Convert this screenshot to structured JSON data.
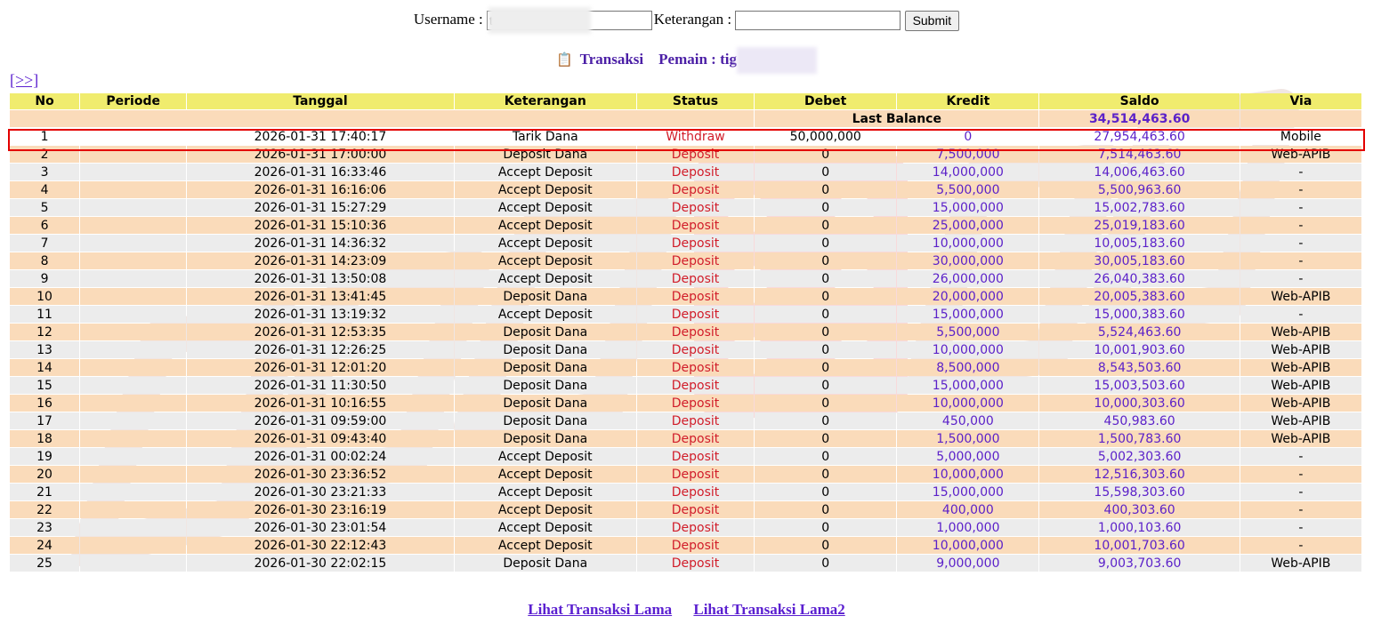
{
  "form": {
    "username_label": "Username :",
    "username_value": "t",
    "keterangan_label": "Keterangan :",
    "keterangan_value": "",
    "submit_label": "Submit"
  },
  "heading": {
    "icon": "clipboard-icon",
    "transaksi": "Transaksi",
    "pemain": "Pemain : tig"
  },
  "next_link": "[>>]",
  "columns": [
    "No",
    "Periode",
    "Tanggal",
    "Keterangan",
    "Status",
    "Debet",
    "Kredit",
    "Saldo",
    "Via"
  ],
  "last_balance": {
    "label": "Last Balance",
    "value": "34,514,463.60"
  },
  "rows": [
    {
      "no": "1",
      "periode": "",
      "tanggal": "2026-01-31 17:40:17",
      "keterangan": "Tarik Dana",
      "status": "Withdraw",
      "debet": "50,000,000",
      "kredit": "0",
      "saldo": "27,954,463.60",
      "via": "Mobile"
    },
    {
      "no": "2",
      "periode": "",
      "tanggal": "2026-01-31 17:00:00",
      "keterangan": "Deposit Dana",
      "status": "Deposit",
      "debet": "0",
      "kredit": "7,500,000",
      "saldo": "7,514,463.60",
      "via": "Web-APIB"
    },
    {
      "no": "3",
      "periode": "",
      "tanggal": "2026-01-31 16:33:46",
      "keterangan": "Accept Deposit",
      "status": "Deposit",
      "debet": "0",
      "kredit": "14,000,000",
      "saldo": "14,006,463.60",
      "via": "-"
    },
    {
      "no": "4",
      "periode": "",
      "tanggal": "2026-01-31 16:16:06",
      "keterangan": "Accept Deposit",
      "status": "Deposit",
      "debet": "0",
      "kredit": "5,500,000",
      "saldo": "5,500,963.60",
      "via": "-"
    },
    {
      "no": "5",
      "periode": "",
      "tanggal": "2026-01-31 15:27:29",
      "keterangan": "Accept Deposit",
      "status": "Deposit",
      "debet": "0",
      "kredit": "15,000,000",
      "saldo": "15,002,783.60",
      "via": "-"
    },
    {
      "no": "6",
      "periode": "",
      "tanggal": "2026-01-31 15:10:36",
      "keterangan": "Accept Deposit",
      "status": "Deposit",
      "debet": "0",
      "kredit": "25,000,000",
      "saldo": "25,019,183.60",
      "via": "-"
    },
    {
      "no": "7",
      "periode": "",
      "tanggal": "2026-01-31 14:36:32",
      "keterangan": "Accept Deposit",
      "status": "Deposit",
      "debet": "0",
      "kredit": "10,000,000",
      "saldo": "10,005,183.60",
      "via": "-"
    },
    {
      "no": "8",
      "periode": "",
      "tanggal": "2026-01-31 14:23:09",
      "keterangan": "Accept Deposit",
      "status": "Deposit",
      "debet": "0",
      "kredit": "30,000,000",
      "saldo": "30,005,183.60",
      "via": "-"
    },
    {
      "no": "9",
      "periode": "",
      "tanggal": "2026-01-31 13:50:08",
      "keterangan": "Accept Deposit",
      "status": "Deposit",
      "debet": "0",
      "kredit": "26,000,000",
      "saldo": "26,040,383.60",
      "via": "-"
    },
    {
      "no": "10",
      "periode": "",
      "tanggal": "2026-01-31 13:41:45",
      "keterangan": "Deposit Dana",
      "status": "Deposit",
      "debet": "0",
      "kredit": "20,000,000",
      "saldo": "20,005,383.60",
      "via": "Web-APIB"
    },
    {
      "no": "11",
      "periode": "",
      "tanggal": "2026-01-31 13:19:32",
      "keterangan": "Accept Deposit",
      "status": "Deposit",
      "debet": "0",
      "kredit": "15,000,000",
      "saldo": "15,000,383.60",
      "via": "-"
    },
    {
      "no": "12",
      "periode": "",
      "tanggal": "2026-01-31 12:53:35",
      "keterangan": "Deposit Dana",
      "status": "Deposit",
      "debet": "0",
      "kredit": "5,500,000",
      "saldo": "5,524,463.60",
      "via": "Web-APIB"
    },
    {
      "no": "13",
      "periode": "",
      "tanggal": "2026-01-31 12:26:25",
      "keterangan": "Deposit Dana",
      "status": "Deposit",
      "debet": "0",
      "kredit": "10,000,000",
      "saldo": "10,001,903.60",
      "via": "Web-APIB"
    },
    {
      "no": "14",
      "periode": "",
      "tanggal": "2026-01-31 12:01:20",
      "keterangan": "Deposit Dana",
      "status": "Deposit",
      "debet": "0",
      "kredit": "8,500,000",
      "saldo": "8,543,503.60",
      "via": "Web-APIB"
    },
    {
      "no": "15",
      "periode": "",
      "tanggal": "2026-01-31 11:30:50",
      "keterangan": "Deposit Dana",
      "status": "Deposit",
      "debet": "0",
      "kredit": "15,000,000",
      "saldo": "15,003,503.60",
      "via": "Web-APIB"
    },
    {
      "no": "16",
      "periode": "",
      "tanggal": "2026-01-31 10:16:55",
      "keterangan": "Deposit Dana",
      "status": "Deposit",
      "debet": "0",
      "kredit": "10,000,000",
      "saldo": "10,000,303.60",
      "via": "Web-APIB"
    },
    {
      "no": "17",
      "periode": "",
      "tanggal": "2026-01-31 09:59:00",
      "keterangan": "Deposit Dana",
      "status": "Deposit",
      "debet": "0",
      "kredit": "450,000",
      "saldo": "450,983.60",
      "via": "Web-APIB"
    },
    {
      "no": "18",
      "periode": "",
      "tanggal": "2026-01-31 09:43:40",
      "keterangan": "Deposit Dana",
      "status": "Deposit",
      "debet": "0",
      "kredit": "1,500,000",
      "saldo": "1,500,783.60",
      "via": "Web-APIB"
    },
    {
      "no": "19",
      "periode": "",
      "tanggal": "2026-01-31 00:02:24",
      "keterangan": "Accept Deposit",
      "status": "Deposit",
      "debet": "0",
      "kredit": "5,000,000",
      "saldo": "5,002,303.60",
      "via": "-"
    },
    {
      "no": "20",
      "periode": "",
      "tanggal": "2026-01-30 23:36:52",
      "keterangan": "Accept Deposit",
      "status": "Deposit",
      "debet": "0",
      "kredit": "10,000,000",
      "saldo": "12,516,303.60",
      "via": "-"
    },
    {
      "no": "21",
      "periode": "",
      "tanggal": "2026-01-30 23:21:33",
      "keterangan": "Accept Deposit",
      "status": "Deposit",
      "debet": "0",
      "kredit": "15,000,000",
      "saldo": "15,598,303.60",
      "via": "-"
    },
    {
      "no": "22",
      "periode": "",
      "tanggal": "2026-01-30 23:16:19",
      "keterangan": "Accept Deposit",
      "status": "Deposit",
      "debet": "0",
      "kredit": "400,000",
      "saldo": "400,303.60",
      "via": "-"
    },
    {
      "no": "23",
      "periode": "",
      "tanggal": "2026-01-30 23:01:54",
      "keterangan": "Accept Deposit",
      "status": "Deposit",
      "debet": "0",
      "kredit": "1,000,000",
      "saldo": "1,000,103.60",
      "via": "-"
    },
    {
      "no": "24",
      "periode": "",
      "tanggal": "2026-01-30 22:12:43",
      "keterangan": "Accept Deposit",
      "status": "Deposit",
      "debet": "0",
      "kredit": "10,000,000",
      "saldo": "10,001,703.60",
      "via": "-"
    },
    {
      "no": "25",
      "periode": "",
      "tanggal": "2026-01-30 22:02:15",
      "keterangan": "Deposit Dana",
      "status": "Deposit",
      "debet": "0",
      "kredit": "9,000,000",
      "saldo": "9,003,703.60",
      "via": "Web-APIB"
    }
  ],
  "bottom_links": [
    "Lihat Transaksi Lama",
    "Lihat Transaksi Lama2"
  ],
  "colors": {
    "header_bg": "#f0ec6e",
    "row_odd": "#fadbba",
    "row_even": "#ececec",
    "link": "#5a1fd0",
    "status_red": "#d11d2a",
    "highlight_border": "#e30000"
  }
}
